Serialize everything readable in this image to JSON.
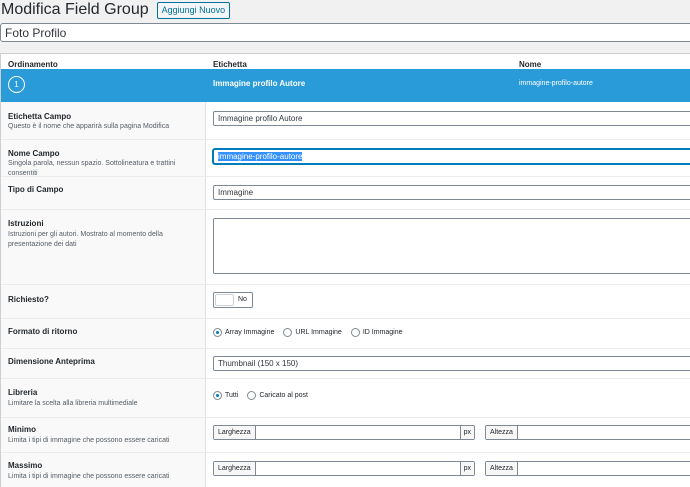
{
  "header": {
    "title": "Modifica Field Group",
    "add_new_label": "Aggiungi Nuovo"
  },
  "group_title": "Foto Profilo",
  "table": {
    "columns": [
      "Ordinamento",
      "Etichetta",
      "Nome"
    ]
  },
  "field": {
    "order": "1",
    "label": "Immagine profilo Autore",
    "name": "immagine-profilo-autore"
  },
  "settings": {
    "label_field": {
      "title": "Etichetta Campo",
      "desc": "Questo è il nome che apparirà sulla pagina Modifica",
      "value": "Immagine profilo Autore"
    },
    "name_field": {
      "title": "Nome Campo",
      "desc": "Singola parola, nessun spazio. Sottolineatura e trattini consentiti",
      "value": "immagine-profilo-autore"
    },
    "type_field": {
      "title": "Tipo di Campo",
      "value": "Immagine"
    },
    "instructions": {
      "title": "Istruzioni",
      "desc": "Istruzioni per gli autori. Mostrato al momento della presentazione dei dati",
      "value": ""
    },
    "required": {
      "title": "Richiesto?",
      "value": "No"
    },
    "return_format": {
      "title": "Formato di ritorno",
      "options": [
        "Array Immagine",
        "URL Immagine",
        "ID Immagine"
      ],
      "selected": 0
    },
    "preview_size": {
      "title": "Dimensione Anteprima",
      "value": "Thumbnail (150 x 150)"
    },
    "library": {
      "title": "Libreria",
      "desc": "Limitare la scelta alla libreria multimediale",
      "options": [
        "Tutti",
        "Caricato al post"
      ],
      "selected": 0
    },
    "minimum": {
      "title": "Minimo",
      "desc": "Limita i tipi di immagine che possono essere caricati",
      "width_label": "Larghezza",
      "height_label": "Altezza",
      "unit": "px"
    },
    "maximum": {
      "title": "Massimo",
      "desc": "Limita i tipi di immagine che possono essere caricati",
      "width_label": "Larghezza",
      "height_label": "Altezza",
      "unit": "px"
    }
  },
  "colors": {
    "accent": "#2a9bd9",
    "link": "#0071a1"
  }
}
